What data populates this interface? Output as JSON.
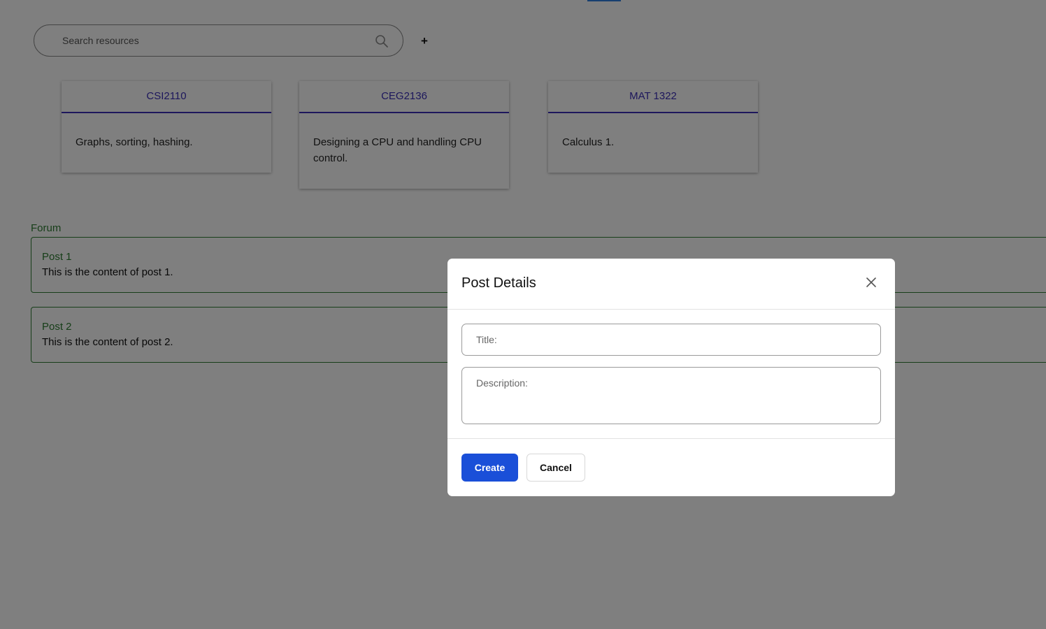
{
  "search": {
    "placeholder": "Search resources"
  },
  "add_button": {
    "label": "+"
  },
  "courses": [
    {
      "code": "CSI2110",
      "description": "Graphs, sorting, hashing."
    },
    {
      "code": "CEG2136",
      "description": "Designing a CPU and handling CPU control."
    },
    {
      "code": "MAT 1322",
      "description": "Calculus 1."
    }
  ],
  "forum": {
    "label": "Forum",
    "posts": [
      {
        "title": "Post 1",
        "content": "This is the content of post 1."
      },
      {
        "title": "Post 2",
        "content": "This is the content of post 2."
      }
    ]
  },
  "modal": {
    "title": "Post Details",
    "title_placeholder": "Title:",
    "description_placeholder": "Description:",
    "create_label": "Create",
    "cancel_label": "Cancel"
  },
  "colors": {
    "accent": "#3b2fb8",
    "forum_green": "#2e7d32",
    "primary_button": "#1a4fd8",
    "tab_indicator": "#2f7fe0"
  },
  "icons": {
    "search": "search-icon",
    "close": "close-icon"
  }
}
